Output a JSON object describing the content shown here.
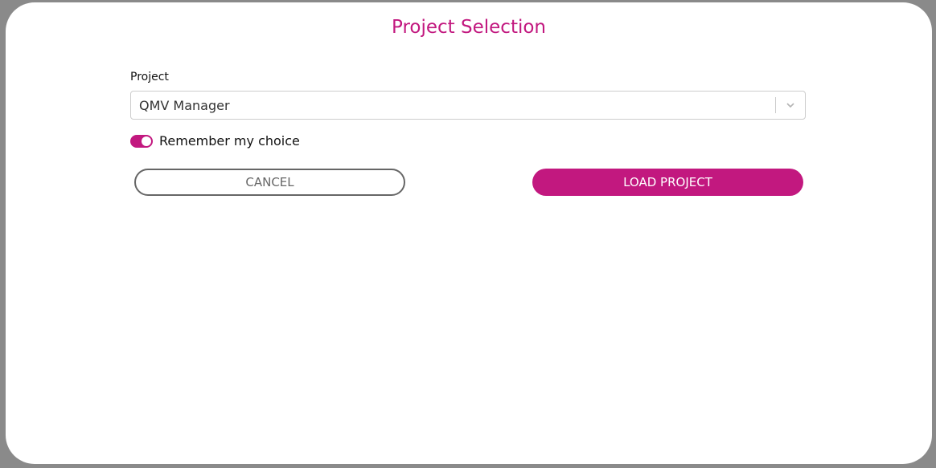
{
  "dialog": {
    "title": "Project Selection",
    "project_field": {
      "label": "Project",
      "selected_value": "QMV Manager"
    },
    "remember_toggle": {
      "label": "Remember my choice",
      "checked": true
    },
    "buttons": {
      "cancel_label": "CANCEL",
      "load_label": "LOAD PROJECT"
    }
  },
  "colors": {
    "accent": "#c2187f",
    "backdrop": "#8a8a8a"
  },
  "icons": {
    "dropdown": "chevron-down-icon"
  }
}
